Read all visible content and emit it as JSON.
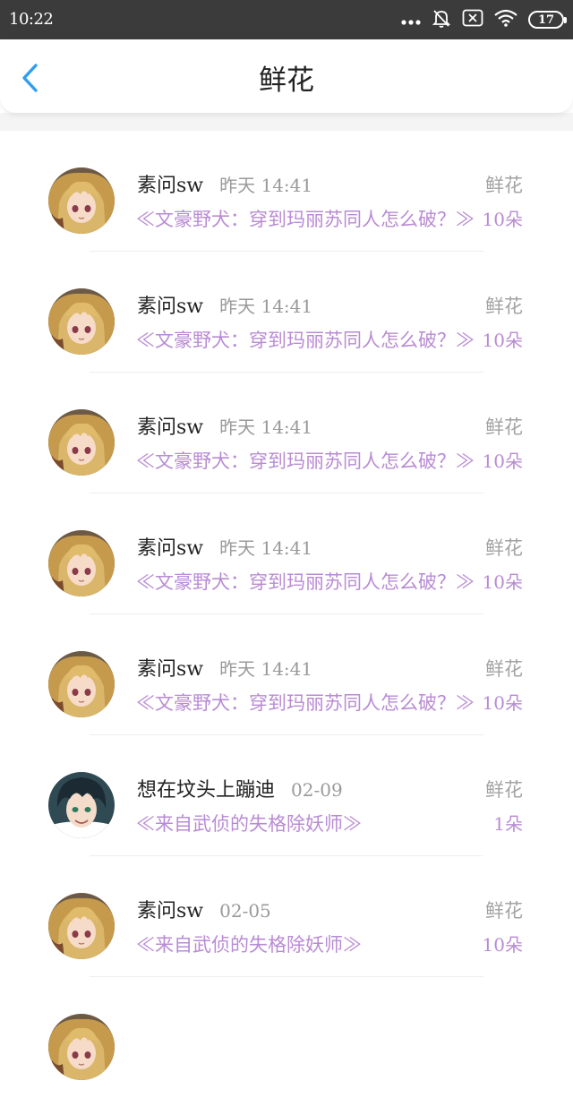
{
  "status_bar": {
    "time": "10:22",
    "icons": [
      "more-dots-icon",
      "bell-muted-icon",
      "sim-off-icon",
      "wifi-icon",
      "battery-icon"
    ],
    "battery": "17"
  },
  "header": {
    "back_icon": "chevron-left-icon",
    "title": "鲜花"
  },
  "colors": {
    "accent": "#2f9ef0",
    "book": "#b98bd4",
    "muted": "#9a9a9a"
  },
  "gifts": [
    {
      "avatar": "blonde-anime-girl",
      "user": "素问sw",
      "time": "昨天  14:41",
      "gift": "鲜花",
      "book": "≪文豪野犬：穿到玛丽苏同人怎么破？≫",
      "count": "10朵"
    },
    {
      "avatar": "blonde-anime-girl",
      "user": "素问sw",
      "time": "昨天  14:41",
      "gift": "鲜花",
      "book": "≪文豪野犬：穿到玛丽苏同人怎么破？≫",
      "count": "10朵"
    },
    {
      "avatar": "blonde-anime-girl",
      "user": "素问sw",
      "time": "昨天  14:41",
      "gift": "鲜花",
      "book": "≪文豪野犬：穿到玛丽苏同人怎么破？≫",
      "count": "10朵"
    },
    {
      "avatar": "blonde-anime-girl",
      "user": "素问sw",
      "time": "昨天  14:41",
      "gift": "鲜花",
      "book": "≪文豪野犬：穿到玛丽苏同人怎么破？≫",
      "count": "10朵"
    },
    {
      "avatar": "blonde-anime-girl",
      "user": "素问sw",
      "time": "昨天  14:41",
      "gift": "鲜花",
      "book": "≪文豪野犬：穿到玛丽苏同人怎么破？≫",
      "count": "10朵"
    },
    {
      "avatar": "dark-haired-anime-boy",
      "user": "想在坟头上蹦迪",
      "time": "02-09",
      "gift": "鲜花",
      "book": "≪来自武侦的失格除妖师≫",
      "count": "1朵"
    },
    {
      "avatar": "blonde-anime-girl",
      "user": "素问sw",
      "time": "02-05",
      "gift": "鲜花",
      "book": "≪来自武侦的失格除妖师≫",
      "count": "10朵"
    },
    {
      "avatar": "blonde-anime-girl",
      "user": "",
      "time": "",
      "gift": "",
      "book": "",
      "count": ""
    }
  ]
}
